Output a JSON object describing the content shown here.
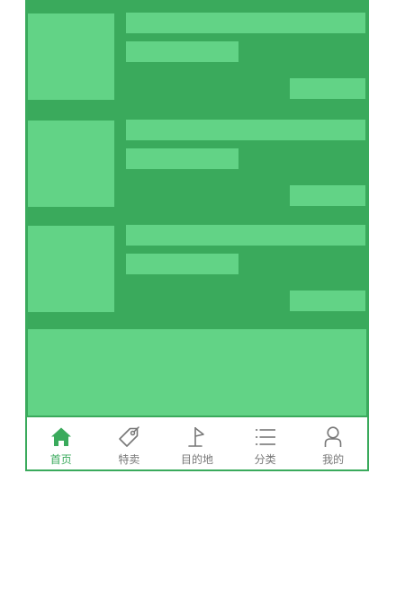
{
  "colors": {
    "accent": "#3aaa5c",
    "placeholder": "#62d386",
    "inactive_text": "#777777"
  },
  "tabbar": {
    "items": [
      {
        "label": "首页",
        "icon": "home-icon",
        "active": true
      },
      {
        "label": "特卖",
        "icon": "price-tag-icon",
        "active": false
      },
      {
        "label": "目的地",
        "icon": "flag-icon",
        "active": false
      },
      {
        "label": "分类",
        "icon": "list-icon",
        "active": false
      },
      {
        "label": "我的",
        "icon": "user-icon",
        "active": false
      }
    ]
  }
}
